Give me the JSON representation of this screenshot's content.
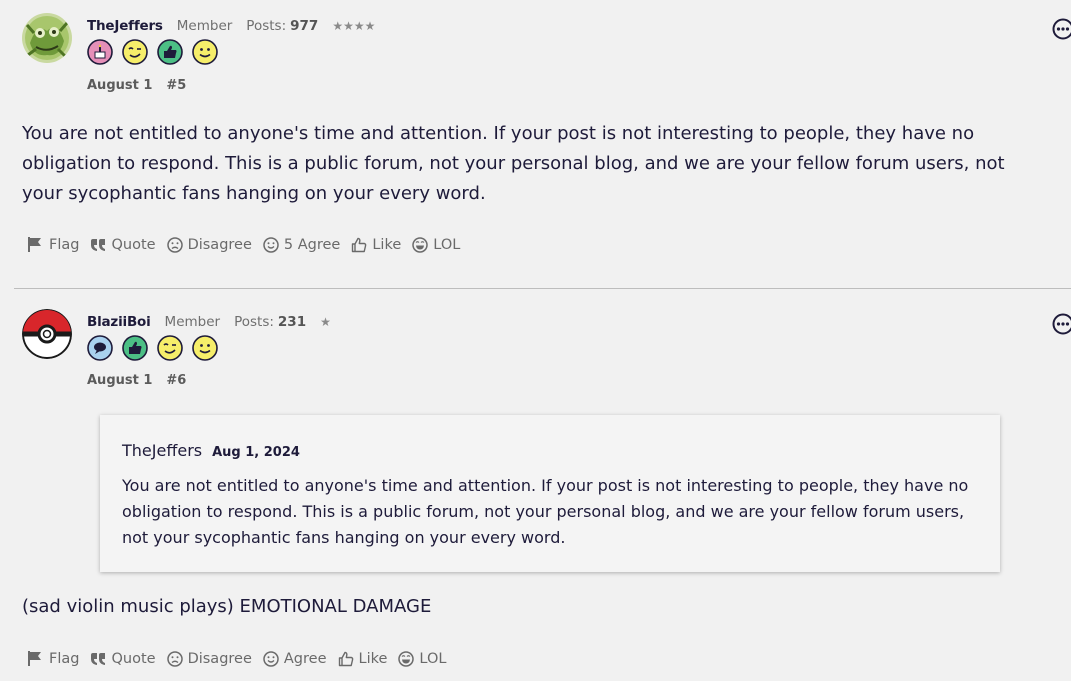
{
  "posts": [
    {
      "username": "TheJeffers",
      "role": "Member",
      "posts_label": "Posts:",
      "posts_count": "977",
      "stars": "★★★★",
      "badges": [
        "cake-badge-icon",
        "wink-badge-icon",
        "thumbs-up-badge-icon",
        "smile-badge-icon"
      ],
      "date": "August 1",
      "post_number": "#5",
      "body": "You are not entitled to anyone's time and attention. If your post is not interesting to people, they have no obligation to respond. This is a public forum, not your personal blog, and we are your fellow forum users, not your sycophantic fans hanging on your every word.",
      "actions": {
        "flag": "Flag",
        "quote": "Quote",
        "disagree": "Disagree",
        "agree": "5 Agree",
        "like": "Like",
        "lol": "LOL"
      }
    },
    {
      "username": "BlaziiBoi",
      "role": "Member",
      "posts_label": "Posts:",
      "posts_count": "231",
      "stars": "★",
      "badges": [
        "speech-bubble-badge-icon",
        "thumbs-up-badge-icon",
        "wink-badge-icon",
        "smile-badge-icon"
      ],
      "date": "August 1",
      "post_number": "#6",
      "quote": {
        "author": "TheJeffers",
        "date": "Aug 1, 2024",
        "text": "You are not entitled to anyone's time and attention. If your post is not interesting to people, they have no obligation to respond. This is a public forum, not your personal blog, and we are your fellow forum users, not your sycophantic fans hanging on your every word."
      },
      "body": "(sad violin music plays) EMOTIONAL DAMAGE",
      "actions": {
        "flag": "Flag",
        "quote": "Quote",
        "disagree": "Disagree",
        "agree": "Agree",
        "like": "Like",
        "lol": "LOL"
      }
    }
  ],
  "colors": {
    "background": "#f1f1f1",
    "text": "#1e1b3a",
    "muted": "#6a6a6a"
  }
}
